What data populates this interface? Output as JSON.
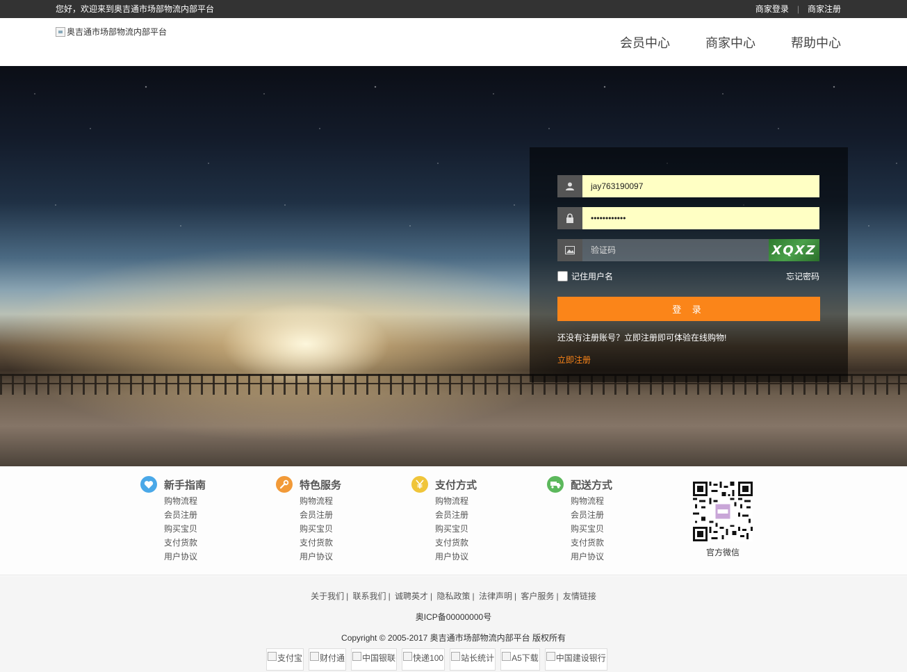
{
  "topbar": {
    "welcome": "您好，欢迎来到奥吉通市场部物流内部平台",
    "merchant_login": "商家登录",
    "separator": "|",
    "merchant_register": "商家注册"
  },
  "header": {
    "logo_alt": "奥吉通市场部物流内部平台",
    "nav": [
      "会员中心",
      "商家中心",
      "帮助中心"
    ]
  },
  "login": {
    "username_value": "jay763190097",
    "password_value": "••••••••••••",
    "captcha_placeholder": "验证码",
    "captcha_image_text": "XQXZ",
    "remember_label": "记住用户名",
    "forgot_label": "忘记密码",
    "login_button": "登 录",
    "register_tip": "还没有注册账号？立即注册即可体验在线购物!",
    "register_link": "立即注册"
  },
  "services": [
    {
      "title": "新手指南",
      "icon": "heart-icon",
      "color": "#4aa8e8",
      "items": [
        "购物流程",
        "会员注册",
        "购买宝贝",
        "支付货款",
        "用户协议"
      ]
    },
    {
      "title": "特色服务",
      "icon": "wrench-icon",
      "color": "#f29a38",
      "items": [
        "购物流程",
        "会员注册",
        "购买宝贝",
        "支付货款",
        "用户协议"
      ]
    },
    {
      "title": "支付方式",
      "icon": "yen-icon",
      "color": "#f0c53a",
      "items": [
        "购物流程",
        "会员注册",
        "购买宝贝",
        "支付货款",
        "用户协议"
      ]
    },
    {
      "title": "配送方式",
      "icon": "truck-icon",
      "color": "#5cb85c",
      "items": [
        "购物流程",
        "会员注册",
        "购买宝贝",
        "支付货款",
        "用户协议"
      ]
    }
  ],
  "qr": {
    "label": "官方微信"
  },
  "footer": {
    "links": [
      "关于我们",
      "联系我们",
      "诚聘英才",
      "隐私政策",
      "法律声明",
      "客户服务",
      "友情链接"
    ],
    "icp": "奥ICP备00000000号",
    "copyright": "Copyright © 2005-2017 奥吉通市场部物流内部平台 版权所有",
    "partners": [
      "支付宝",
      "财付通",
      "中国银联",
      "快递100",
      "站长统计",
      "A5下载",
      "中国建设银行"
    ]
  },
  "colors": {
    "accent": "#fb8519",
    "topbar": "#333333",
    "input_fill": "#ffffc4"
  }
}
